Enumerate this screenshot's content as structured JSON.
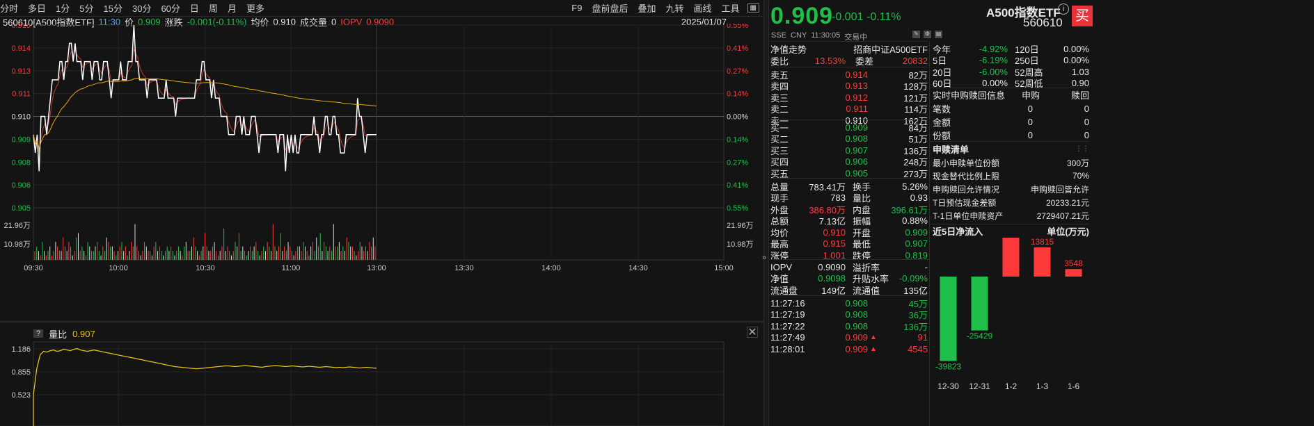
{
  "toolbar": {
    "items": [
      "分时",
      "多日",
      "1分",
      "5分",
      "15分",
      "30分",
      "60分",
      "日",
      "周",
      "月",
      "更多"
    ],
    "right_items": [
      "F9",
      "盘前盘后",
      "叠加",
      "九转",
      "画线",
      "工具"
    ]
  },
  "chart_header": {
    "code_name": "560610[A500指数ETF]",
    "time": "11:30",
    "price_label": "价",
    "price": "0.909",
    "change_label": "涨跌",
    "change": "-0.001(-0.11%)",
    "avg_label": "均价",
    "avg": "0.910",
    "vol_label": "成交量",
    "vol": "0",
    "iopv_label": "IOPV",
    "iopv": "0.9090",
    "date": "2025/01/07"
  },
  "price_axis": {
    "left": [
      "0.915",
      "0.914",
      "0.913",
      "0.911",
      "0.910",
      "0.909",
      "0.908",
      "0.906",
      "0.905"
    ],
    "right": [
      "0.55%",
      "0.41%",
      "0.27%",
      "0.14%",
      "0.00%",
      "0.14%",
      "0.27%",
      "0.41%",
      "0.55%"
    ],
    "prev_close": 0.91,
    "max": 0.915,
    "min": 0.905
  },
  "vol_axis": {
    "left": [
      "21.96万",
      "10.98万"
    ],
    "right": [
      "21.96万",
      "10.98万"
    ]
  },
  "time_axis": [
    "09:30",
    "10:00",
    "10:30",
    "11:00",
    "13:00",
    "13:30",
    "14:00",
    "14:30",
    "15:00"
  ],
  "lower": {
    "help": "?",
    "label": "量比",
    "value": "0.907",
    "axis": [
      "1.186",
      "0.855",
      "0.523"
    ]
  },
  "quote": {
    "price": "0.909",
    "change": "-0.001",
    "pct": "-0.11%",
    "name": "A500指数ETF",
    "code": "560610",
    "buy_label": "买",
    "market": "SSE",
    "currency": "CNY",
    "time": "11:30:05",
    "status": "交易中",
    "nav_label": "净值走势",
    "fund_name": "招商中证A500ETF",
    "webi_label": "委比",
    "webi": "13.53%",
    "wecha_label": "委差",
    "wecha": "20832"
  },
  "asks": [
    {
      "l": "卖五",
      "p": "0.914",
      "v": "82万",
      "c": "red"
    },
    {
      "l": "卖四",
      "p": "0.913",
      "v": "128万",
      "c": "red"
    },
    {
      "l": "卖三",
      "p": "0.912",
      "v": "121万",
      "c": "red"
    },
    {
      "l": "卖二",
      "p": "0.911",
      "v": "114万",
      "c": "red"
    },
    {
      "l": "卖一",
      "p": "0.910",
      "v": "162万",
      "c": "white"
    }
  ],
  "bids": [
    {
      "l": "买一",
      "p": "0.909",
      "v": "84万",
      "c": "green"
    },
    {
      "l": "买二",
      "p": "0.908",
      "v": "51万",
      "c": "green"
    },
    {
      "l": "买三",
      "p": "0.907",
      "v": "136万",
      "c": "green"
    },
    {
      "l": "买四",
      "p": "0.906",
      "v": "248万",
      "c": "green"
    },
    {
      "l": "买五",
      "p": "0.905",
      "v": "273万",
      "c": "green"
    }
  ],
  "stats": [
    [
      "总量",
      "783.41万",
      "white",
      "换手",
      "5.26%",
      "white"
    ],
    [
      "现手",
      "783",
      "white",
      "量比",
      "0.93",
      "white"
    ],
    [
      "外盘",
      "386.80万",
      "red",
      "内盘",
      "396.61万",
      "green"
    ],
    [
      "总额",
      "7.13亿",
      "white",
      "振幅",
      "0.88%",
      "white"
    ],
    [
      "均价",
      "0.910",
      "red",
      "开盘",
      "0.909",
      "green"
    ],
    [
      "最高",
      "0.915",
      "red",
      "最低",
      "0.907",
      "green"
    ],
    [
      "涨停",
      "1.001",
      "red",
      "跌停",
      "0.819",
      "green"
    ]
  ],
  "stats2": [
    [
      "IOPV",
      "0.9090",
      "white",
      "溢折率",
      "-",
      "white"
    ],
    [
      "净值",
      "0.9098",
      "green",
      "升贴水率",
      "-0.09%",
      "green"
    ],
    [
      "流通盘",
      "149亿",
      "white",
      "流通值",
      "135亿",
      "white"
    ]
  ],
  "ticks": [
    [
      "11:27:16",
      "0.908",
      "45万",
      "green"
    ],
    [
      "11:27:19",
      "0.908",
      "36万",
      "green"
    ],
    [
      "11:27:22",
      "0.908",
      "136万",
      "green"
    ],
    [
      "11:27:49",
      "0.909",
      "91",
      "red"
    ],
    [
      "11:28:01",
      "0.909",
      "4545",
      "red"
    ]
  ],
  "perf": [
    [
      "今年",
      "-4.92%",
      "green",
      "120日",
      "0.00%",
      "white"
    ],
    [
      "5日",
      "-6.19%",
      "green",
      "250日",
      "0.00%",
      "white"
    ],
    [
      "20日",
      "-6.00%",
      "green",
      "52周高",
      "1.03",
      "white"
    ],
    [
      "60日",
      "0.00%",
      "white",
      "52周低",
      "0.90",
      "white"
    ]
  ],
  "redeem": {
    "title": "实时申购赎回信息",
    "col1": "申购",
    "col2": "赎回",
    "rows": [
      [
        "笔数",
        "0",
        "0"
      ],
      [
        "金额",
        "0",
        "0"
      ],
      [
        "份额",
        "0",
        "0"
      ]
    ]
  },
  "sgqd": {
    "title": "申赎清单",
    "rows": [
      [
        "最小申赎单位份额",
        "300万"
      ],
      [
        "现金替代比例上限",
        "70%"
      ],
      [
        "申购赎回允许情况",
        "申购赎回皆允许"
      ],
      [
        "T日预估现金差额",
        "20233.21元"
      ],
      [
        "T-1日单位申赎资产",
        "2729407.21元"
      ]
    ]
  },
  "inflow": {
    "title": "近5日净流入",
    "unit": "单位(万元)"
  },
  "chart_data": {
    "type": "bar",
    "title": "近5日净流入",
    "ylabel": "单位(万元)",
    "categories": [
      "12-30",
      "12-31",
      "1-2",
      "1-3",
      "1-6"
    ],
    "values": [
      -39823,
      -25429,
      22478,
      13815,
      3548
    ]
  },
  "price_series": [
    0.909,
    0.908,
    0.909,
    0.907,
    0.91,
    0.91,
    0.91,
    0.909,
    0.91,
    0.911,
    0.912,
    0.912,
    0.912,
    0.912,
    0.913,
    0.913,
    0.912,
    0.913,
    0.913,
    0.914,
    0.914,
    0.913,
    0.914,
    0.913,
    0.913,
    0.913,
    0.912,
    0.913,
    0.913,
    0.913,
    0.913,
    0.912,
    0.913,
    0.913,
    0.913,
    0.912,
    0.912,
    0.913,
    0.913,
    0.913,
    0.912,
    0.911,
    0.912,
    0.912,
    0.912,
    0.912,
    0.913,
    0.912,
    0.912,
    0.912,
    0.913,
    0.913,
    0.913,
    0.915,
    0.913,
    0.913,
    0.912,
    0.912,
    0.912,
    0.912,
    0.911,
    0.912,
    0.912,
    0.912,
    0.912,
    0.912,
    0.911,
    0.911,
    0.911,
    0.911,
    0.912,
    0.911,
    0.911,
    0.911,
    0.911,
    0.91,
    0.911,
    0.911,
    0.911,
    0.911,
    0.911,
    0.911,
    0.911,
    0.911,
    0.911,
    0.911,
    0.912,
    0.912,
    0.912,
    0.913,
    0.913,
    0.912,
    0.912,
    0.912,
    0.911,
    0.912,
    0.911,
    0.911,
    0.911,
    0.91,
    0.91,
    0.91,
    0.91,
    0.909,
    0.909,
    0.909,
    0.909,
    0.91,
    0.91,
    0.91,
    0.909,
    0.91,
    0.909,
    0.909,
    0.909,
    0.91,
    0.91,
    0.91,
    0.909,
    0.908,
    0.909,
    0.909,
    0.909,
    0.909,
    0.909,
    0.909,
    0.909,
    0.909,
    0.909,
    0.908,
    0.909,
    0.909,
    0.909,
    0.907,
    0.909,
    0.908,
    0.909,
    0.908,
    0.909,
    0.908,
    0.908,
    0.909,
    0.909,
    0.909,
    0.909,
    0.909,
    0.909,
    0.909,
    0.91,
    0.909,
    0.909,
    0.908,
    0.909,
    0.909,
    0.91,
    0.91,
    0.909,
    0.909,
    0.91,
    0.91,
    0.909,
    0.909,
    0.908,
    0.908,
    0.908,
    0.909,
    0.909,
    0.909,
    0.909,
    0.909,
    0.909,
    0.911,
    0.91,
    0.91,
    0.909,
    0.908,
    0.909,
    0.909,
    0.909,
    0.909,
    0.909,
    0.909
  ],
  "avg_series_start": 0.909,
  "volume_series": [
    2,
    3,
    2,
    1,
    4,
    2,
    1,
    2,
    3,
    1,
    2,
    4,
    3,
    2,
    2,
    5,
    3,
    2,
    4,
    3,
    1,
    2,
    5,
    6,
    2,
    3,
    2,
    1,
    4,
    3,
    2,
    2,
    3,
    4,
    2,
    1,
    3,
    2,
    5,
    4,
    3,
    3,
    2,
    1,
    2,
    3,
    4,
    2,
    3,
    1,
    2,
    4,
    3,
    8,
    3,
    2,
    1,
    2,
    4,
    3,
    2,
    2,
    1,
    3,
    4,
    2,
    3,
    2,
    1,
    2,
    3,
    2,
    3,
    2,
    1,
    2,
    3,
    2,
    1,
    3,
    4,
    2,
    2,
    3,
    5,
    3,
    2,
    1,
    2,
    3,
    6,
    3,
    2,
    2,
    3,
    4,
    2,
    1,
    2,
    3,
    7,
    2,
    3,
    2,
    1,
    2,
    4,
    3,
    6,
    2,
    3,
    2,
    1,
    2,
    3,
    2,
    3,
    4,
    2,
    1,
    2,
    3,
    2,
    4,
    3,
    2,
    8,
    3,
    2,
    3,
    6,
    2,
    3,
    2,
    4,
    3,
    2,
    1,
    2,
    3,
    3,
    2,
    4,
    3,
    2,
    1,
    3,
    4,
    2,
    5,
    3,
    6,
    2,
    4,
    3,
    2,
    3,
    2,
    8,
    3,
    3,
    4,
    2,
    3,
    2,
    5,
    4,
    3,
    3,
    2,
    1,
    2,
    4,
    3,
    2,
    3,
    2,
    4,
    3,
    5,
    3
  ],
  "ratio_series": [
    0.523,
    0.9,
    1.1,
    1.15,
    1.14,
    1.16,
    1.17,
    1.15,
    1.16,
    1.18,
    1.17,
    1.16,
    1.18,
    1.19,
    1.17,
    1.16,
    1.15,
    1.16,
    1.17,
    1.16,
    1.15,
    1.14,
    1.13,
    1.12,
    1.11,
    1.1,
    1.09,
    1.08,
    1.07,
    1.06,
    1.05,
    1.04,
    1.03,
    1.02,
    1.01,
    1.0,
    0.99,
    0.98,
    0.97,
    0.96,
    0.95,
    0.94,
    0.93,
    0.925,
    0.92,
    0.915,
    0.91,
    0.905,
    0.9,
    0.9,
    0.905,
    0.91,
    0.915,
    0.92,
    0.925,
    0.93,
    0.935,
    0.94,
    0.94,
    0.935,
    0.93,
    0.935,
    0.94,
    0.945,
    0.94,
    0.935,
    0.93,
    0.925,
    0.92,
    0.93,
    0.935,
    0.94,
    0.945,
    0.94,
    0.935,
    0.93,
    0.935,
    0.94,
    0.935,
    0.93,
    0.925,
    0.93,
    0.935,
    0.93,
    0.925,
    0.92,
    0.925,
    0.93,
    0.925,
    0.92,
    0.915,
    0.92,
    0.915,
    0.92,
    0.925,
    0.92,
    0.915,
    0.91,
    0.915,
    0.92,
    0.915,
    0.91,
    0.907
  ],
  "colors": {
    "bg": "#141414",
    "red": "#ff3a3a",
    "green": "#1fbf4a",
    "price_line": "#ffffff",
    "avg_line": "#e6a817",
    "accent": "#e6c31a"
  }
}
